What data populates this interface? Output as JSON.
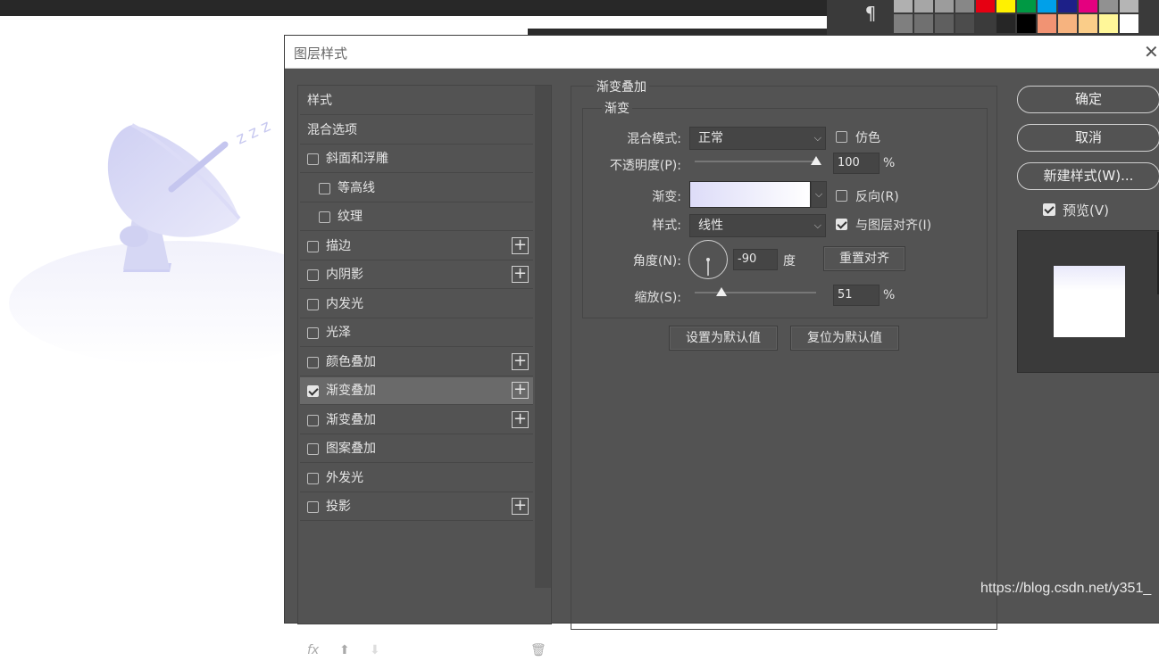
{
  "app": {
    "paragraph_icon": "pilcrow-icon"
  },
  "swatches": [
    "#b0b0b0",
    "#a6a6a6",
    "#9c9c9c",
    "#878787",
    "#e60012",
    "#fff100",
    "#009944",
    "#00a0e9",
    "#1d2088",
    "#e4007f",
    "#919191",
    "#b5b5b5",
    "#7f7f7f",
    "#707070",
    "#5f5f5f",
    "#4c4c4c",
    "#3b3b3b",
    "#262626",
    "#000000",
    "#f19373",
    "#f6b37f",
    "#facd89",
    "#fff799",
    "#ffffff",
    "#9fd09f",
    "#96c89c",
    "#8fc7a8",
    "#8acbc1",
    "#88c2d9",
    "#7fb4dd",
    "#8096c9",
    "#8a86c1",
    "#9f88bf",
    "#c08ec0",
    "#e891bd",
    "#ec92a7"
  ],
  "dialog": {
    "title": "图层样式",
    "close_icon": "close-icon"
  },
  "style_list": {
    "items": [
      {
        "label": "样式",
        "has_checkbox": false,
        "checked": false,
        "has_plus": false,
        "indent": 0,
        "selected": false
      },
      {
        "label": "混合选项",
        "has_checkbox": false,
        "checked": false,
        "has_plus": false,
        "indent": 0,
        "selected": false
      },
      {
        "label": "斜面和浮雕",
        "has_checkbox": true,
        "checked": false,
        "has_plus": false,
        "indent": 0,
        "selected": false
      },
      {
        "label": "等高线",
        "has_checkbox": true,
        "checked": false,
        "has_plus": false,
        "indent": 1,
        "selected": false
      },
      {
        "label": "纹理",
        "has_checkbox": true,
        "checked": false,
        "has_plus": false,
        "indent": 1,
        "selected": false
      },
      {
        "label": "描边",
        "has_checkbox": true,
        "checked": false,
        "has_plus": true,
        "indent": 0,
        "selected": false
      },
      {
        "label": "内阴影",
        "has_checkbox": true,
        "checked": false,
        "has_plus": true,
        "indent": 0,
        "selected": false
      },
      {
        "label": "内发光",
        "has_checkbox": true,
        "checked": false,
        "has_plus": false,
        "indent": 0,
        "selected": false
      },
      {
        "label": "光泽",
        "has_checkbox": true,
        "checked": false,
        "has_plus": false,
        "indent": 0,
        "selected": false
      },
      {
        "label": "颜色叠加",
        "has_checkbox": true,
        "checked": false,
        "has_plus": true,
        "indent": 0,
        "selected": false
      },
      {
        "label": "渐变叠加",
        "has_checkbox": true,
        "checked": true,
        "has_plus": true,
        "indent": 0,
        "selected": true
      },
      {
        "label": "渐变叠加",
        "has_checkbox": true,
        "checked": false,
        "has_plus": true,
        "indent": 0,
        "selected": false
      },
      {
        "label": "图案叠加",
        "has_checkbox": true,
        "checked": false,
        "has_plus": false,
        "indent": 0,
        "selected": false
      },
      {
        "label": "外发光",
        "has_checkbox": true,
        "checked": false,
        "has_plus": false,
        "indent": 0,
        "selected": false
      },
      {
        "label": "投影",
        "has_checkbox": true,
        "checked": false,
        "has_plus": true,
        "indent": 0,
        "selected": false
      }
    ],
    "footer": {
      "fx": "fx",
      "up_icon": "arrow-up-icon",
      "down_icon": "arrow-down-icon",
      "delete_icon": "trash-icon"
    }
  },
  "gradient_overlay": {
    "group_title": "渐变叠加",
    "sub_title": "渐变",
    "blend_mode_label": "混合模式:",
    "blend_mode_value": "正常",
    "dither_label": "仿色",
    "dither_checked": false,
    "opacity_label": "不透明度(P):",
    "opacity_value": "100",
    "opacity_fraction": 1.0,
    "opacity_unit": "%",
    "gradient_label": "渐变:",
    "gradient_start": "#dddcf8",
    "gradient_end": "#ffffff",
    "reverse_label": "反向(R)",
    "reverse_checked": false,
    "style_label": "样式:",
    "style_value": "线性",
    "align_label": "与图层对齐(I)",
    "align_checked": true,
    "angle_label": "角度(N):",
    "angle_value": "-90",
    "angle_unit": "度",
    "reset_align_label": "重置对齐",
    "scale_label": "缩放(S):",
    "scale_value": "51",
    "scale_fraction": 0.22,
    "scale_unit": "%",
    "make_default_label": "设置为默认值",
    "reset_default_label": "复位为默认值"
  },
  "actions": {
    "ok_label": "确定",
    "cancel_label": "取消",
    "new_style_label": "新建样式(W)...",
    "preview_label": "预览(V)",
    "preview_checked": true
  },
  "watermark": "https://blog.csdn.net/y351_"
}
